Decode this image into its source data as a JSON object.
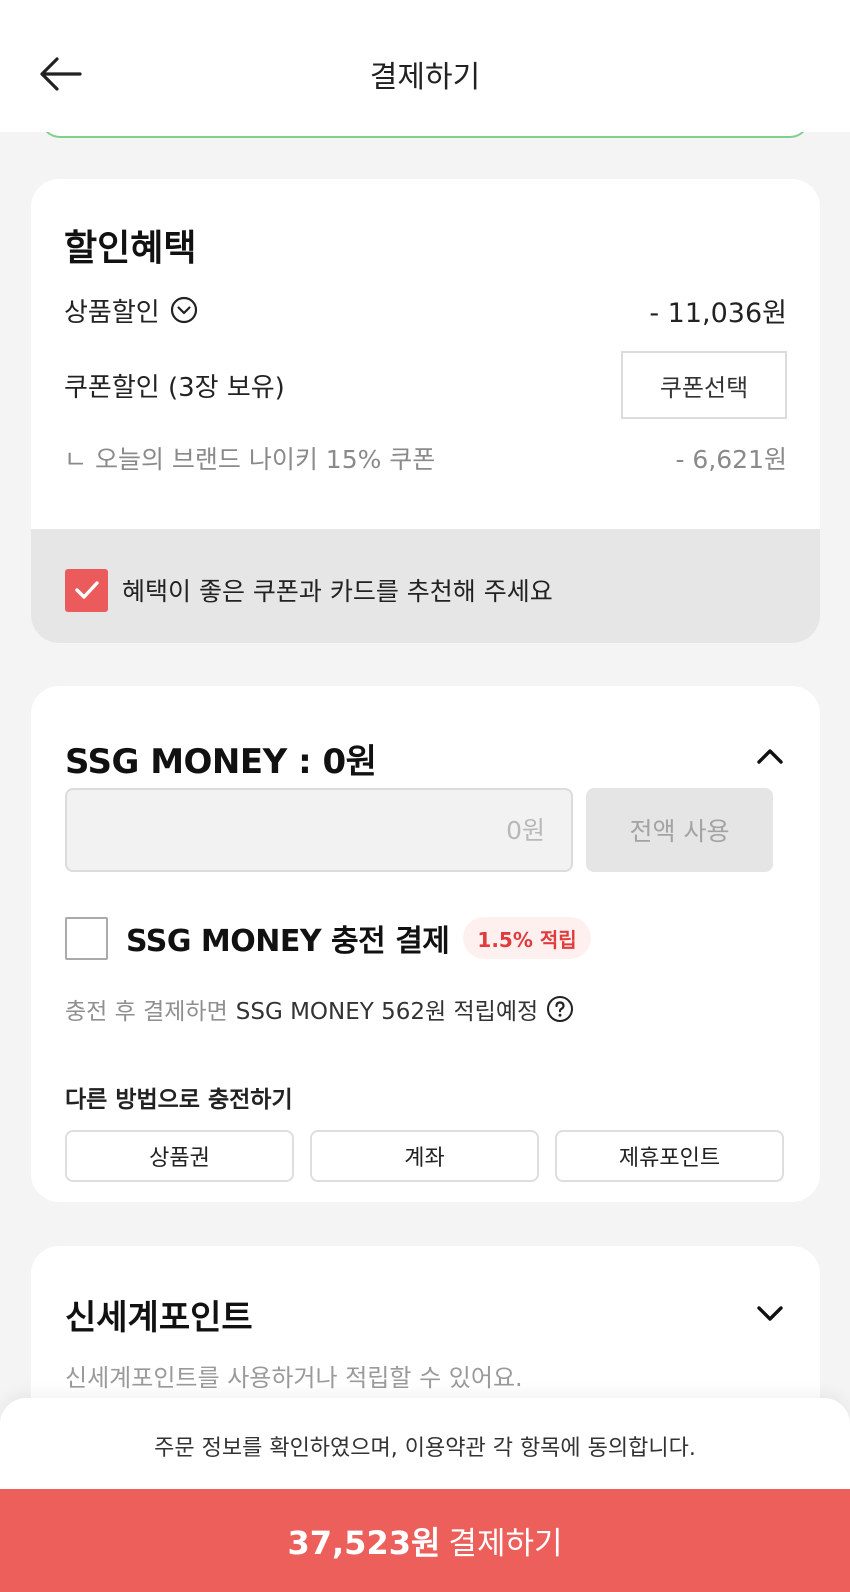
{
  "header": {
    "title": "결제하기",
    "back_icon": "arrow-left-icon"
  },
  "discount": {
    "title": "할인혜택",
    "product_discount_label": "상품할인",
    "product_discount_amount": "- 11,036원",
    "coupon_discount_label": "쿠폰할인 (3장 보유)",
    "coupon_select_button": "쿠폰선택",
    "applied_coupon_label": "ㄴ 오늘의 브랜드 나이키 15% 쿠폰",
    "applied_coupon_amount": "- 6,621원",
    "recommend_checked": true,
    "recommend_label": "혜택이 좋은 쿠폰과 카드를 추천해 주세요"
  },
  "ssg_money": {
    "title": "SSG MONEY : 0원",
    "amount_placeholder": "0원",
    "use_all_button": "전액 사용",
    "charge_pay_label": "SSG MONEY 충전 결제",
    "charge_badge": "1.5% 적립",
    "accrue_note_prefix": "충전 후 결제하면",
    "accrue_note_main": "SSG MONEY 562원 적립예정",
    "other_charge_title": "다른 방법으로 충전하기",
    "other_charge_options": [
      "상품권",
      "계좌",
      "제휴포인트"
    ]
  },
  "shinsegae_point": {
    "title": "신세계포인트",
    "description": "신세계포인트를 사용하거나 적립할 수 있어요."
  },
  "footer": {
    "agreement_text": "주문 정보를 확인하였으며, 이용약관 각 항목에 동의합니다.",
    "pay_amount": "37,523원",
    "pay_label": "결제하기"
  },
  "colors": {
    "accent": "#ec5f5b",
    "badge_text": "#e03c3c",
    "prev_card_border": "#7ed08a"
  }
}
